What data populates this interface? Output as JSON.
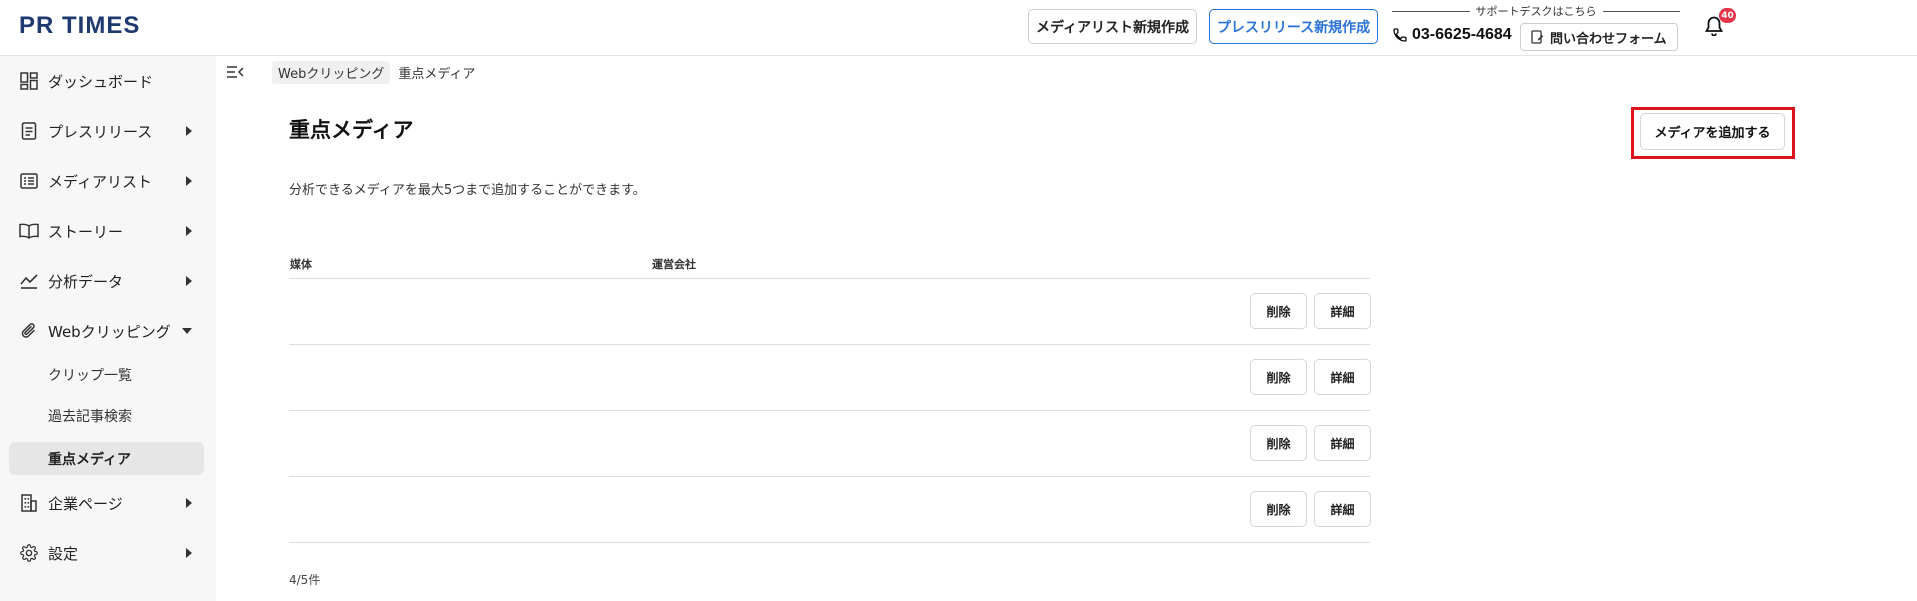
{
  "header": {
    "logo": "PR TIMES",
    "media_list_button": "メディアリスト新規作成",
    "press_release_button": "プレスリリース新規作成",
    "support_caption": "サポートデスクはこちら",
    "phone": "03-6625-4684",
    "contact_button": "問い合わせフォーム",
    "notification_count": "40"
  },
  "sidebar": {
    "items": [
      {
        "label": "ダッシュボード",
        "icon": "dashboard-icon"
      },
      {
        "label": "プレスリリース",
        "icon": "document-icon"
      },
      {
        "label": "メディアリスト",
        "icon": "list-icon"
      },
      {
        "label": "ストーリー",
        "icon": "book-icon"
      },
      {
        "label": "分析データ",
        "icon": "chart-icon"
      },
      {
        "label": "Webクリッピング",
        "icon": "paperclip-icon"
      },
      {
        "label": "企業ページ",
        "icon": "building-icon"
      },
      {
        "label": "設定",
        "icon": "gear-icon"
      }
    ],
    "sub_items": [
      {
        "label": "クリップ一覧"
      },
      {
        "label": "過去記事検索"
      },
      {
        "label": "重点メディア"
      }
    ]
  },
  "breadcrumb": {
    "parent": "Webクリッピング",
    "current": "重点メディア"
  },
  "main": {
    "title": "重点メディア",
    "add_button": "メディアを追加する",
    "description": "分析できるメディアを最大5つまで追加することができます。",
    "columns": [
      "媒体",
      "運営会社"
    ],
    "rows": [
      {
        "media": "",
        "company": "",
        "delete_label": "削除",
        "detail_label": "詳細"
      },
      {
        "media": "",
        "company": "",
        "delete_label": "削除",
        "detail_label": "詳細"
      },
      {
        "media": "",
        "company": "",
        "delete_label": "削除",
        "detail_label": "詳細"
      },
      {
        "media": "",
        "company": "",
        "delete_label": "削除",
        "detail_label": "詳細"
      }
    ],
    "count": "4/5件"
  },
  "colors": {
    "brand": "#1f3a6e",
    "accent": "#2a73d8",
    "highlight": "#e0121d",
    "badge": "#e6334a"
  }
}
